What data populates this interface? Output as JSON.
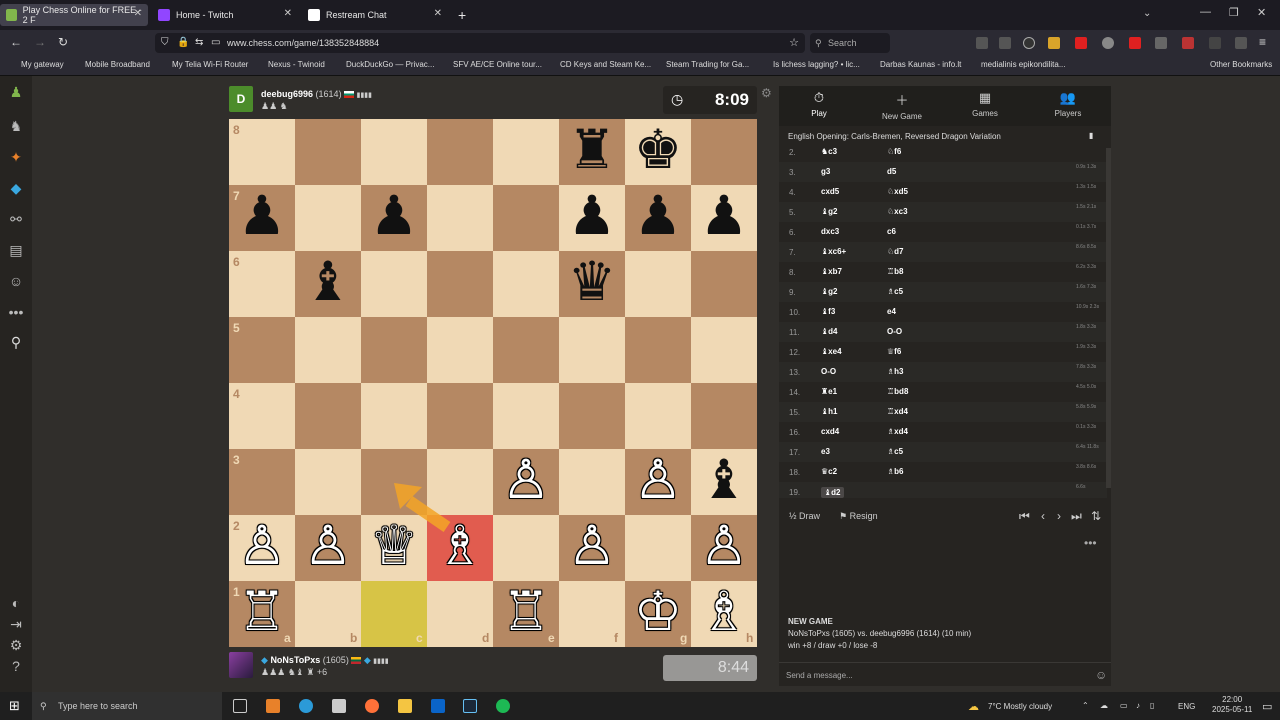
{
  "browser": {
    "tabs": [
      {
        "title": "Play Chess Online for FREE - 2 F",
        "active": true
      },
      {
        "title": "Home - Twitch",
        "active": false
      },
      {
        "title": "Restream Chat",
        "active": false
      }
    ],
    "new_tab": "+",
    "url": "www.chess.com/game/138352848884",
    "search_placeholder": "Search",
    "bookmarks": [
      "My gateway",
      "Mobile Broadband",
      "My Telia Wi-Fi Router",
      "Nexus - Twinoid",
      "DuckDuckGo — Privac...",
      "SFV AE/CE Online tour...",
      "CD Keys and Steam Ke...",
      "Steam Trading for Ga...",
      "Is lichess lagging? • lic...",
      "Darbas Kaunas - info.lt",
      "medialinis epikondilita...",
      "Other Bookmarks"
    ]
  },
  "top_player": {
    "initial": "D",
    "name": "deebug6996",
    "rating": "(1614)",
    "clock": "8:09",
    "badges": "▮▮▮▮"
  },
  "bottom_player": {
    "name": "NoNsToPxs",
    "rating": "(1605)",
    "clock": "8:44",
    "captured": "+6",
    "badges": "▮▮▮▮"
  },
  "board": {
    "ranks": [
      "8",
      "7",
      "6",
      "5",
      "4",
      "3",
      "2",
      "1"
    ],
    "files": [
      "a",
      "b",
      "c",
      "d",
      "e",
      "f",
      "g",
      "h"
    ],
    "pieces": [
      {
        "sq": "f8",
        "p": "♜",
        "c": "b"
      },
      {
        "sq": "g8",
        "p": "♚",
        "c": "b"
      },
      {
        "sq": "a7",
        "p": "♟",
        "c": "b"
      },
      {
        "sq": "c7",
        "p": "♟",
        "c": "b"
      },
      {
        "sq": "f7",
        "p": "♟",
        "c": "b"
      },
      {
        "sq": "g7",
        "p": "♟",
        "c": "b"
      },
      {
        "sq": "h7",
        "p": "♟",
        "c": "b"
      },
      {
        "sq": "b6",
        "p": "♝",
        "c": "b"
      },
      {
        "sq": "f6",
        "p": "♛",
        "c": "b"
      },
      {
        "sq": "e3",
        "p": "♙",
        "c": "w"
      },
      {
        "sq": "g3",
        "p": "♙",
        "c": "w"
      },
      {
        "sq": "h3",
        "p": "♝",
        "c": "b"
      },
      {
        "sq": "a2",
        "p": "♙",
        "c": "w"
      },
      {
        "sq": "b2",
        "p": "♙",
        "c": "w"
      },
      {
        "sq": "c2",
        "p": "♕",
        "c": "w"
      },
      {
        "sq": "d2",
        "p": "♗",
        "c": "w"
      },
      {
        "sq": "f2",
        "p": "♙",
        "c": "w"
      },
      {
        "sq": "h2",
        "p": "♙",
        "c": "w"
      },
      {
        "sq": "a1",
        "p": "♖",
        "c": "w"
      },
      {
        "sq": "e1",
        "p": "♖",
        "c": "w"
      },
      {
        "sq": "g1",
        "p": "♔",
        "c": "w"
      },
      {
        "sq": "h1",
        "p": "♗",
        "c": "w"
      }
    ],
    "highlight_red": "d2",
    "highlight_yellow": "c1"
  },
  "panel": {
    "tabs": [
      {
        "label": "Play",
        "icon": "⏱"
      },
      {
        "label": "New Game",
        "icon": "＋"
      },
      {
        "label": "Games",
        "icon": "▦"
      },
      {
        "label": "Players",
        "icon": "👥"
      }
    ],
    "opening": "English Opening: Carls-Bremen, Reversed Dragon Variation",
    "moves": [
      {
        "n": "2.",
        "w": "♞c3",
        "b": "♘f6",
        "t": "1.5s 1.5s"
      },
      {
        "n": "3.",
        "w": "g3",
        "b": "d5",
        "t": "0.9s 1.3s"
      },
      {
        "n": "4.",
        "w": "cxd5",
        "b": "♘xd5",
        "t": "1.3s 1.5s"
      },
      {
        "n": "5.",
        "w": "♝g2",
        "b": "♘xc3",
        "t": "1.5s 2.1s"
      },
      {
        "n": "6.",
        "w": "dxc3",
        "b": "c6",
        "t": "0.1s 3.7s"
      },
      {
        "n": "7.",
        "w": "♝xc6+",
        "b": "♘d7",
        "t": "8.6s 8.5s"
      },
      {
        "n": "8.",
        "w": "♝xb7",
        "b": "♖b8",
        "t": "6.2s 3.3s"
      },
      {
        "n": "9.",
        "w": "♝g2",
        "b": "♗c5",
        "t": "1.6s 7.3s"
      },
      {
        "n": "10.",
        "w": "♝f3",
        "b": "e4",
        "t": "10.9s 2.3s"
      },
      {
        "n": "11.",
        "w": "♝d4",
        "b": "O-O",
        "t": "1.8s 3.3s"
      },
      {
        "n": "12.",
        "w": "♝xe4",
        "b": "♕f6",
        "t": "1.9s 3.3s"
      },
      {
        "n": "13.",
        "w": "O-O",
        "b": "♗h3",
        "t": "7.8s 3.3s"
      },
      {
        "n": "14.",
        "w": "♜e1",
        "b": "♖bd8",
        "t": "4.5s 5.0s"
      },
      {
        "n": "15.",
        "w": "♝h1",
        "b": "♖xd4",
        "t": "5.8s 5.9s"
      },
      {
        "n": "16.",
        "w": "cxd4",
        "b": "♗xd4",
        "t": "0.1s 3.3s"
      },
      {
        "n": "17.",
        "w": "e3",
        "b": "♗c5",
        "t": "6.4s 11.8s"
      },
      {
        "n": "18.",
        "w": "♛c2",
        "b": "♗b6",
        "t": "3.8s 8.6s"
      },
      {
        "n": "19.",
        "w": "♝d2",
        "b": "",
        "t": "6.6s"
      }
    ],
    "draw": "Draw",
    "resign": "Resign",
    "nav": [
      "⏮",
      "‹",
      "›",
      "⏭",
      "⇅"
    ],
    "more": "•••",
    "new_game_title": "NEW GAME",
    "new_game_line": "NoNsToPxs (1605) vs. deebug6996 (1614) (10 min)",
    "new_game_stats": "win +8 / draw +0 / lose -8",
    "chat_placeholder": "Send a message...",
    "chat_icon": "☺"
  },
  "taskbar": {
    "search": "Type here to search",
    "weather": "7°C  Mostly cloudy",
    "lang": "ENG",
    "time": "22:00",
    "date": "2025-05-11"
  },
  "colors": {
    "light": "#f0d9b5",
    "dark": "#b58863",
    "highlight_red": "#e15c4f",
    "highlight_yellow": "#d7c446",
    "arrow": "#f4a526"
  }
}
